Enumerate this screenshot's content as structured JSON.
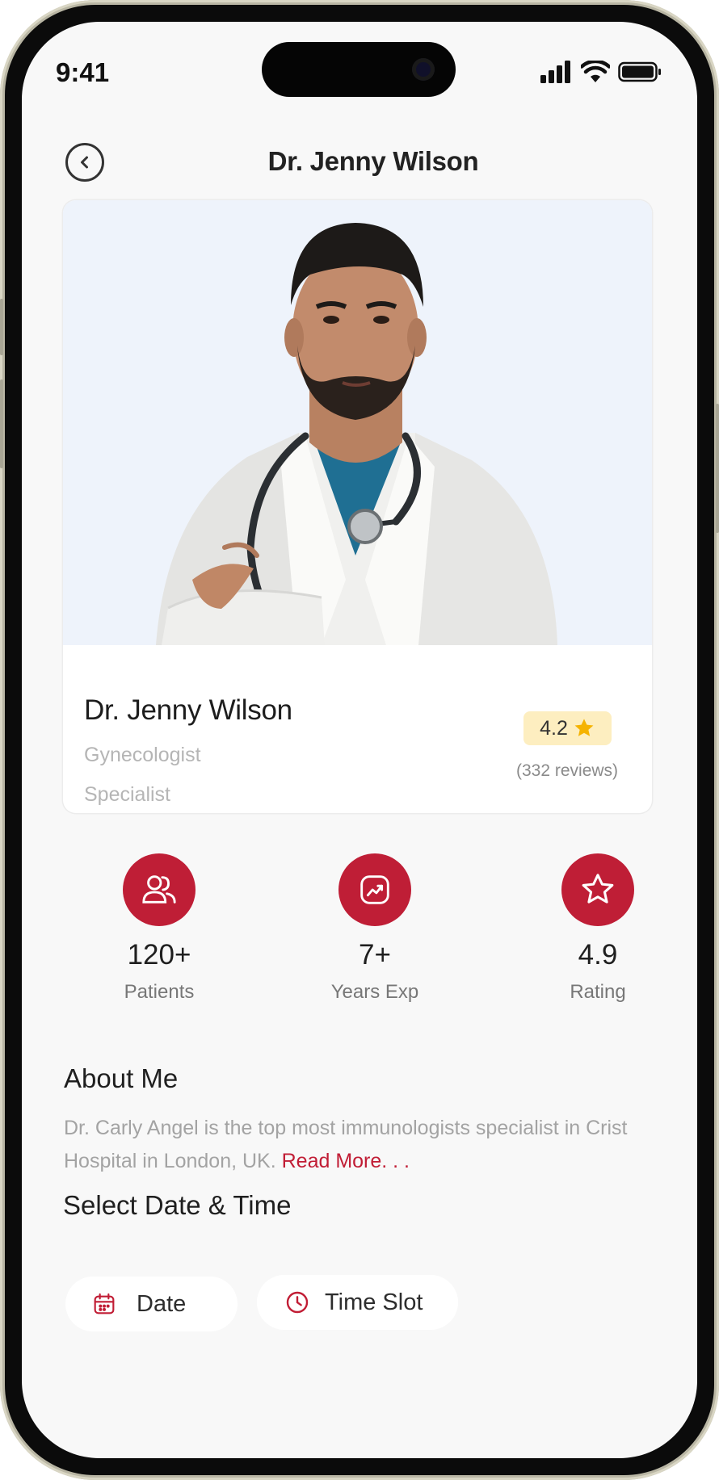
{
  "status_bar": {
    "time": "9:41"
  },
  "header": {
    "title": "Dr. Jenny Wilson"
  },
  "doctor": {
    "name": "Dr. Jenny Wilson",
    "specialty_line1": "Gynecologist",
    "specialty_line2": "Specialist",
    "rating": "4.2",
    "reviews": "(332 reviews)"
  },
  "stats": [
    {
      "icon": "patients-icon",
      "value": "120+",
      "label": "Patients"
    },
    {
      "icon": "experience-icon",
      "value": "7+",
      "label": "Years Exp"
    },
    {
      "icon": "star-icon",
      "value": "4.9",
      "label": "Rating"
    }
  ],
  "about": {
    "title": "About Me",
    "text": "Dr. Carly Angel is the top most immunologists specialist in Crist Hospital in London, UK. ",
    "read_more": "Read More. . ."
  },
  "schedule": {
    "title": "Select Date & Time",
    "date_label": "Date",
    "time_label": "Time Slot"
  },
  "colors": {
    "accent": "#bf1e36",
    "rating_bg": "#fdeec0",
    "star": "#f5b301",
    "background": "#f8f8f8"
  }
}
